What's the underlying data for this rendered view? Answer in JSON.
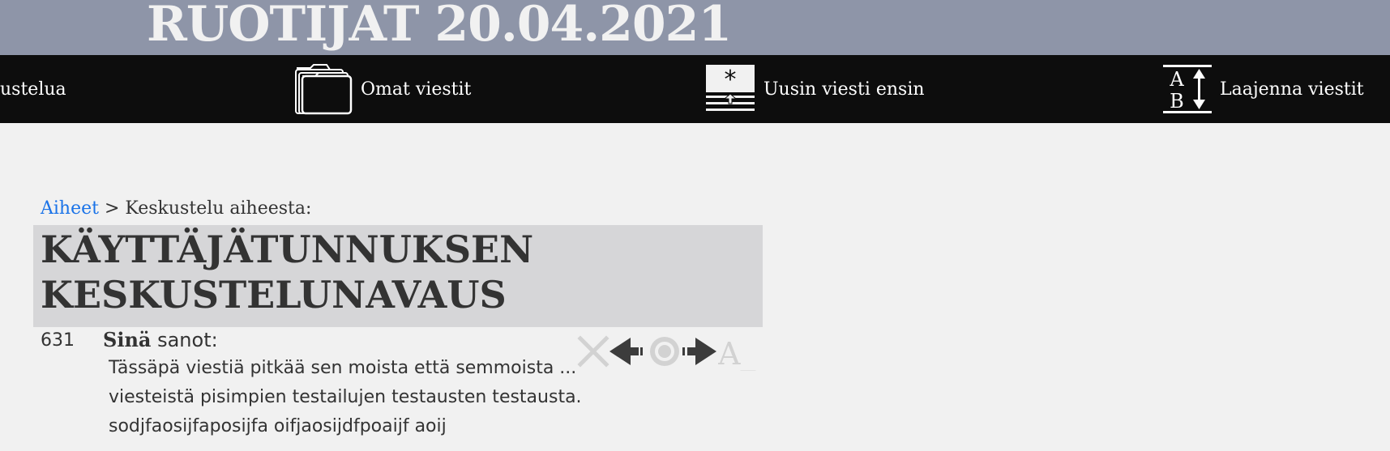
{
  "header": {
    "title": "RUOTIJAT 20.04.2021"
  },
  "menu": {
    "items": [
      {
        "label": "ustelua",
        "icon": "none"
      },
      {
        "label": "Omat viestit",
        "icon": "folder-icon"
      },
      {
        "label": "Uusin viesti ensin",
        "icon": "newest-first-icon"
      },
      {
        "label": "Laajenna viestit",
        "icon": "expand-text-icon"
      }
    ]
  },
  "breadcrumb": {
    "link": "Aiheet",
    "separator": " > ",
    "text": "Keskustelu aiheesta:"
  },
  "topic": {
    "title": "KÄYTTÄJÄTUNNUKSEN KESKUSTELUNAVAUS"
  },
  "message": {
    "number": "631",
    "author": "Sinä",
    "says": " sanot:",
    "lines": [
      "Tässäpä viestiä pitkää sen moista että semmoista ...",
      "viesteistä pisimpien testailujen testausten testausta.",
      "sodjfaosijfaposijfa oifjaosijdfpoaijf aoij"
    ],
    "actions": [
      "delete-icon",
      "move-left-icon",
      "center-target-icon",
      "move-right-icon",
      "text-format-icon"
    ],
    "text_format_glyph": "A_"
  },
  "colors": {
    "banner": "#8e95a8",
    "menubar": "#0d0d0d",
    "page": "#f1f1f1",
    "topic_box": "#d6d6d8",
    "link": "#1a73e8",
    "text": "#333333"
  }
}
